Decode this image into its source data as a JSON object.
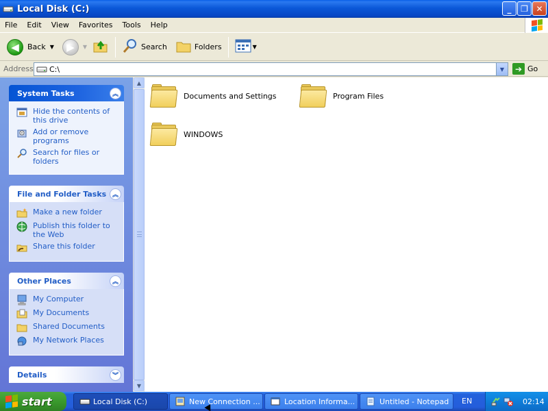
{
  "window": {
    "title": "Local Disk (C:)",
    "controls": [
      "minimize",
      "maximize",
      "close"
    ]
  },
  "menubar": {
    "items": [
      "File",
      "Edit",
      "View",
      "Favorites",
      "Tools",
      "Help"
    ]
  },
  "toolbar": {
    "back_label": "Back",
    "search_label": "Search",
    "folders_label": "Folders"
  },
  "address": {
    "label": "Address",
    "value": "C:\\",
    "go_label": "Go"
  },
  "panels": {
    "system_tasks": {
      "title": "System Tasks",
      "items": [
        {
          "label": "Hide the contents of this drive",
          "icon": "hide-contents-icon"
        },
        {
          "label": "Add or remove programs",
          "icon": "add-remove-programs-icon"
        },
        {
          "label": "Search for files or folders",
          "icon": "search-icon"
        }
      ]
    },
    "file_folder_tasks": {
      "title": "File and Folder Tasks",
      "items": [
        {
          "label": "Make a new folder",
          "icon": "new-folder-icon"
        },
        {
          "label": "Publish this folder to the Web",
          "icon": "publish-web-icon"
        },
        {
          "label": "Share this folder",
          "icon": "share-folder-icon"
        }
      ]
    },
    "other_places": {
      "title": "Other Places",
      "items": [
        {
          "label": "My Computer",
          "icon": "my-computer-icon"
        },
        {
          "label": "My Documents",
          "icon": "my-documents-icon"
        },
        {
          "label": "Shared Documents",
          "icon": "shared-documents-icon"
        },
        {
          "label": "My Network Places",
          "icon": "network-places-icon"
        }
      ]
    },
    "details": {
      "title": "Details"
    }
  },
  "folders": [
    {
      "name": "Documents and Settings"
    },
    {
      "name": "Program Files"
    },
    {
      "name": "WINDOWS"
    }
  ],
  "taskbar": {
    "start_label": "start",
    "tasks": [
      {
        "label": "Local Disk (C:)",
        "active": true
      },
      {
        "label": "New Connection ...",
        "active": false
      },
      {
        "label": "Location Informa...",
        "active": false
      },
      {
        "label": "Untitled - Notepad",
        "active": false
      }
    ],
    "language": "EN",
    "clock": "02:14"
  },
  "colors": {
    "titlebar": "#0846C4",
    "taskpane_link": "#215DC6",
    "start_button": "#3A9A2D",
    "tray": "#0F7DD9"
  }
}
